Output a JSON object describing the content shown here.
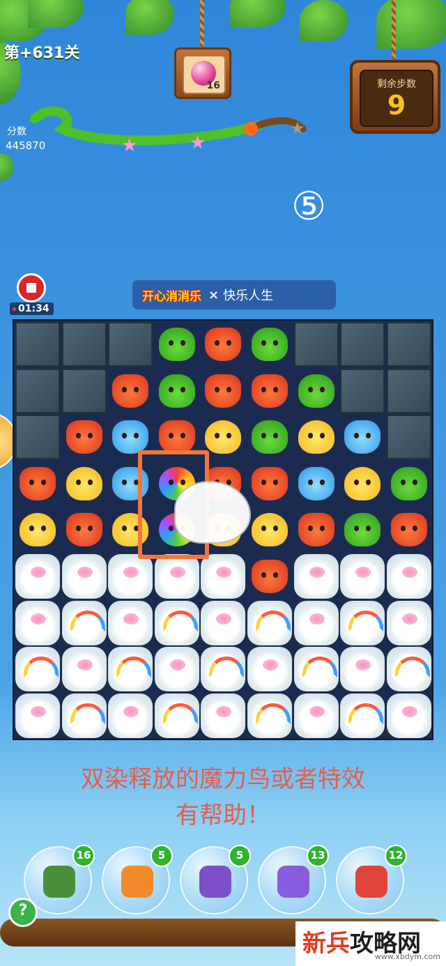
{
  "level": {
    "text": "第+631关"
  },
  "target": {
    "count": "16",
    "icon": "pink-gem-icon"
  },
  "moves": {
    "label": "剩余步数",
    "value": "9"
  },
  "score": {
    "label": "分数",
    "value": "445870"
  },
  "progress": {
    "stars": 2,
    "stars_total": 3
  },
  "step_marker": "⑤",
  "recording": {
    "time": "01:34"
  },
  "banner": {
    "logo": "开心消消乐",
    "x": "×",
    "text": "快乐人生"
  },
  "board": {
    "rows": [
      [
        "stone",
        "stone",
        "stone",
        "frog",
        "fox",
        "frog",
        "stone",
        "stone",
        "stone"
      ],
      [
        "stone",
        "stone",
        "fox",
        "frog",
        "fox",
        "fox",
        "frog",
        "stone",
        "stone"
      ],
      [
        "stone",
        "fox",
        "bear",
        "fox",
        "chick",
        "frog",
        "chick",
        "bear",
        "stone"
      ],
      [
        "fox",
        "chick",
        "bear",
        "bird",
        "fox",
        "fox",
        "bear",
        "chick",
        "frog"
      ],
      [
        "chick",
        "fox",
        "chick",
        "bird",
        "chick",
        "chick",
        "fox",
        "frog",
        "fox"
      ],
      [
        "blossom",
        "blossom",
        "blossom",
        "blossom",
        "blossom",
        "fox",
        "blossom",
        "blossom",
        "blossom"
      ],
      [
        "blossom",
        "rainbow",
        "blossom",
        "rainbow",
        "blossom",
        "rainbow",
        "blossom",
        "rainbow",
        "blossom"
      ],
      [
        "rainbow",
        "blossom",
        "rainbow",
        "blossom",
        "rainbow",
        "blossom",
        "rainbow",
        "blossom",
        "rainbow"
      ],
      [
        "blossom",
        "rainbow",
        "blossom",
        "rainbow",
        "blossom",
        "rainbow",
        "blossom",
        "rainbow",
        "blossom"
      ]
    ]
  },
  "caption": {
    "line1": "双染释放的魔力鸟或者特效",
    "line2": "有帮助！"
  },
  "boosters": [
    {
      "name": "refresh-booster",
      "count": "16",
      "color": "#4a8f3a"
    },
    {
      "name": "clock-booster",
      "count": "5",
      "color": "#f08a2a"
    },
    {
      "name": "swap-booster",
      "count": "5",
      "color": "#7b4fc8"
    },
    {
      "name": "line-booster",
      "count": "13",
      "color": "#8a5be0"
    },
    {
      "name": "rocket-booster",
      "count": "12",
      "color": "#e0443a"
    }
  ],
  "help": "?",
  "watermark": {
    "main_red": "新兵",
    "main_dark": "攻略网",
    "url": "www.xbdym.com"
  }
}
